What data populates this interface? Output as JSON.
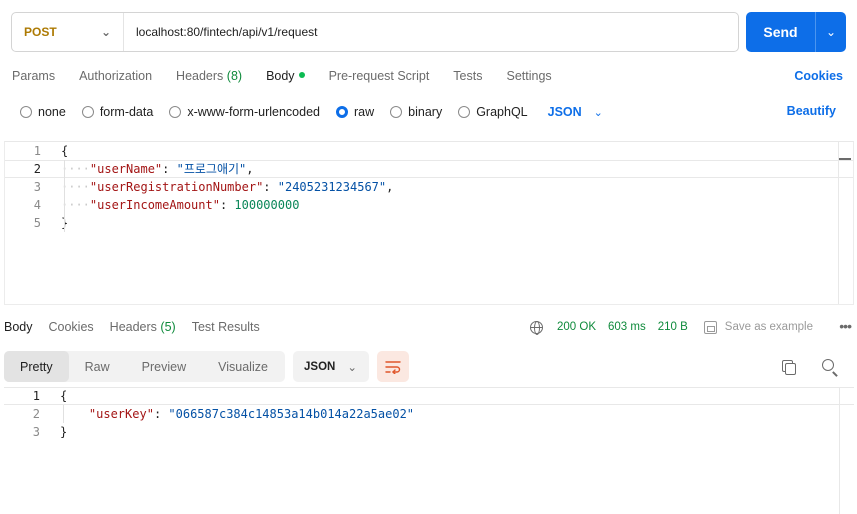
{
  "request": {
    "method": "POST",
    "url": "localhost:80/fintech/api/v1/request",
    "send_label": "Send",
    "tabs": [
      {
        "label": "Params"
      },
      {
        "label": "Authorization"
      },
      {
        "label": "Headers",
        "count": "(8)"
      },
      {
        "label": "Body"
      },
      {
        "label": "Pre-request Script"
      },
      {
        "label": "Tests"
      },
      {
        "label": "Settings"
      }
    ],
    "cookies_label": "Cookies",
    "body_types": [
      "none",
      "form-data",
      "x-www-form-urlencoded",
      "raw",
      "binary",
      "GraphQL"
    ],
    "selected_body_type": "raw",
    "format": "JSON",
    "beautify_label": "Beautify",
    "code": {
      "line_numbers": [
        "1",
        "2",
        "3",
        "4",
        "5"
      ],
      "open_brace": "{",
      "close_brace": "}",
      "fields": [
        {
          "key": "\"userName\"",
          "value": "\"프로그애기\"",
          "type": "string",
          "comma": ","
        },
        {
          "key": "\"userRegistrationNumber\"",
          "value": "\"2405231234567\"",
          "type": "string",
          "comma": ","
        },
        {
          "key": "\"userIncomeAmount\"",
          "value": "100000000",
          "type": "number",
          "comma": ""
        }
      ]
    }
  },
  "response": {
    "tabs": [
      {
        "label": "Body"
      },
      {
        "label": "Cookies"
      },
      {
        "label": "Headers",
        "count": "(5)"
      },
      {
        "label": "Test Results"
      }
    ],
    "status": "200 OK",
    "time": "603 ms",
    "size": "210 B",
    "save_label": "Save as example",
    "more_label": "•••",
    "views": [
      "Pretty",
      "Raw",
      "Preview",
      "Visualize"
    ],
    "format": "JSON",
    "code": {
      "line_numbers": [
        "1",
        "2",
        "3"
      ],
      "open_brace": "{",
      "close_brace": "}",
      "key": "\"userKey\"",
      "value": "\"066587c384c14853a14b014a22a5ae02\""
    }
  },
  "colors": {
    "accent": "#0d6ee8",
    "method": "#ad7a03",
    "success": "#0e8a3b",
    "string": "#0451a5",
    "key": "#a31515",
    "number": "#098658"
  },
  "icons": [
    "chevron-down-icon",
    "globe-icon",
    "save-icon",
    "wrap-icon",
    "copy-icon",
    "search-icon"
  ]
}
